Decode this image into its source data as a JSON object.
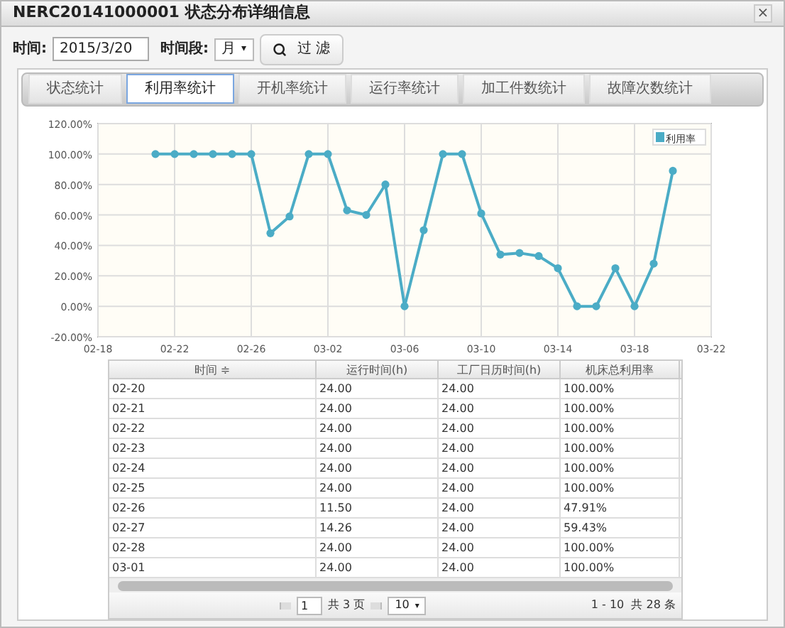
{
  "window": {
    "title": "NERC20141000001 状态分布详细信息",
    "close": "×"
  },
  "filter": {
    "time_label": "时间:",
    "time_value": "2015/3/20",
    "period_label": "时间段:",
    "period_value": "月",
    "period_caret": "▾",
    "filter_button": "过 滤"
  },
  "tabs": [
    {
      "label": "状态统计",
      "selected": false
    },
    {
      "label": "利用率统计",
      "selected": true
    },
    {
      "label": "开机率统计",
      "selected": false
    },
    {
      "label": "运行率统计",
      "selected": false
    },
    {
      "label": "加工件数统计",
      "selected": false
    },
    {
      "label": "故障次数统计",
      "selected": false
    }
  ],
  "chart_data": {
    "type": "line",
    "categories": [
      "02-18",
      null,
      null,
      null,
      "02-22",
      null,
      null,
      null,
      "02-26",
      null,
      null,
      null,
      "03-02",
      null,
      null,
      null,
      "03-06",
      null,
      null,
      null,
      "03-10",
      null,
      null,
      null,
      "03-14",
      null,
      null,
      null,
      "03-18",
      null,
      null,
      null,
      "03-22"
    ],
    "series": [
      {
        "name": "利用率",
        "color": "#4bacc6",
        "marker": "circle",
        "values": [
          null,
          null,
          null,
          100,
          100,
          100,
          100,
          100,
          100,
          48,
          59,
          100,
          100,
          63,
          60,
          80,
          0,
          50,
          100,
          100,
          61,
          34,
          35,
          33,
          25,
          0,
          0,
          25,
          0,
          28,
          89,
          null,
          null
        ]
      }
    ],
    "ylim": [
      -20,
      120
    ],
    "grid": true,
    "yticks": [
      {
        "value": -20,
        "label": "-20.00%"
      },
      {
        "value": 0,
        "label": "0.00%"
      },
      {
        "value": 20,
        "label": "20.00%"
      },
      {
        "value": 40,
        "label": "40.00%"
      },
      {
        "value": 60,
        "label": "60.00%"
      },
      {
        "value": 80,
        "label": "80.00%"
      },
      {
        "value": 100,
        "label": "100.00%"
      },
      {
        "value": 120,
        "label": "120.00%"
      }
    ]
  },
  "table": {
    "columns": [
      "时间 ≑",
      "运行时间(h)",
      "工厂日历时间(h)",
      "机床总利用率"
    ],
    "rows": [
      [
        "02-20",
        "24.00",
        "24.00",
        "100.00%"
      ],
      [
        "02-21",
        "24.00",
        "24.00",
        "100.00%"
      ],
      [
        "02-22",
        "24.00",
        "24.00",
        "100.00%"
      ],
      [
        "02-23",
        "24.00",
        "24.00",
        "100.00%"
      ],
      [
        "02-24",
        "24.00",
        "24.00",
        "100.00%"
      ],
      [
        "02-25",
        "24.00",
        "24.00",
        "100.00%"
      ],
      [
        "02-26",
        "11.50",
        "24.00",
        "47.91%"
      ],
      [
        "02-27",
        "14.26",
        "24.00",
        "59.43%"
      ],
      [
        "02-28",
        "24.00",
        "24.00",
        "100.00%"
      ],
      [
        "03-01",
        "24.00",
        "24.00",
        "100.00%"
      ]
    ]
  },
  "pager": {
    "page_value": "1",
    "page_total": "共 3 页",
    "page_size": "10",
    "page_size_caret": "▾",
    "summary": "1 - 10  共 28 条"
  }
}
